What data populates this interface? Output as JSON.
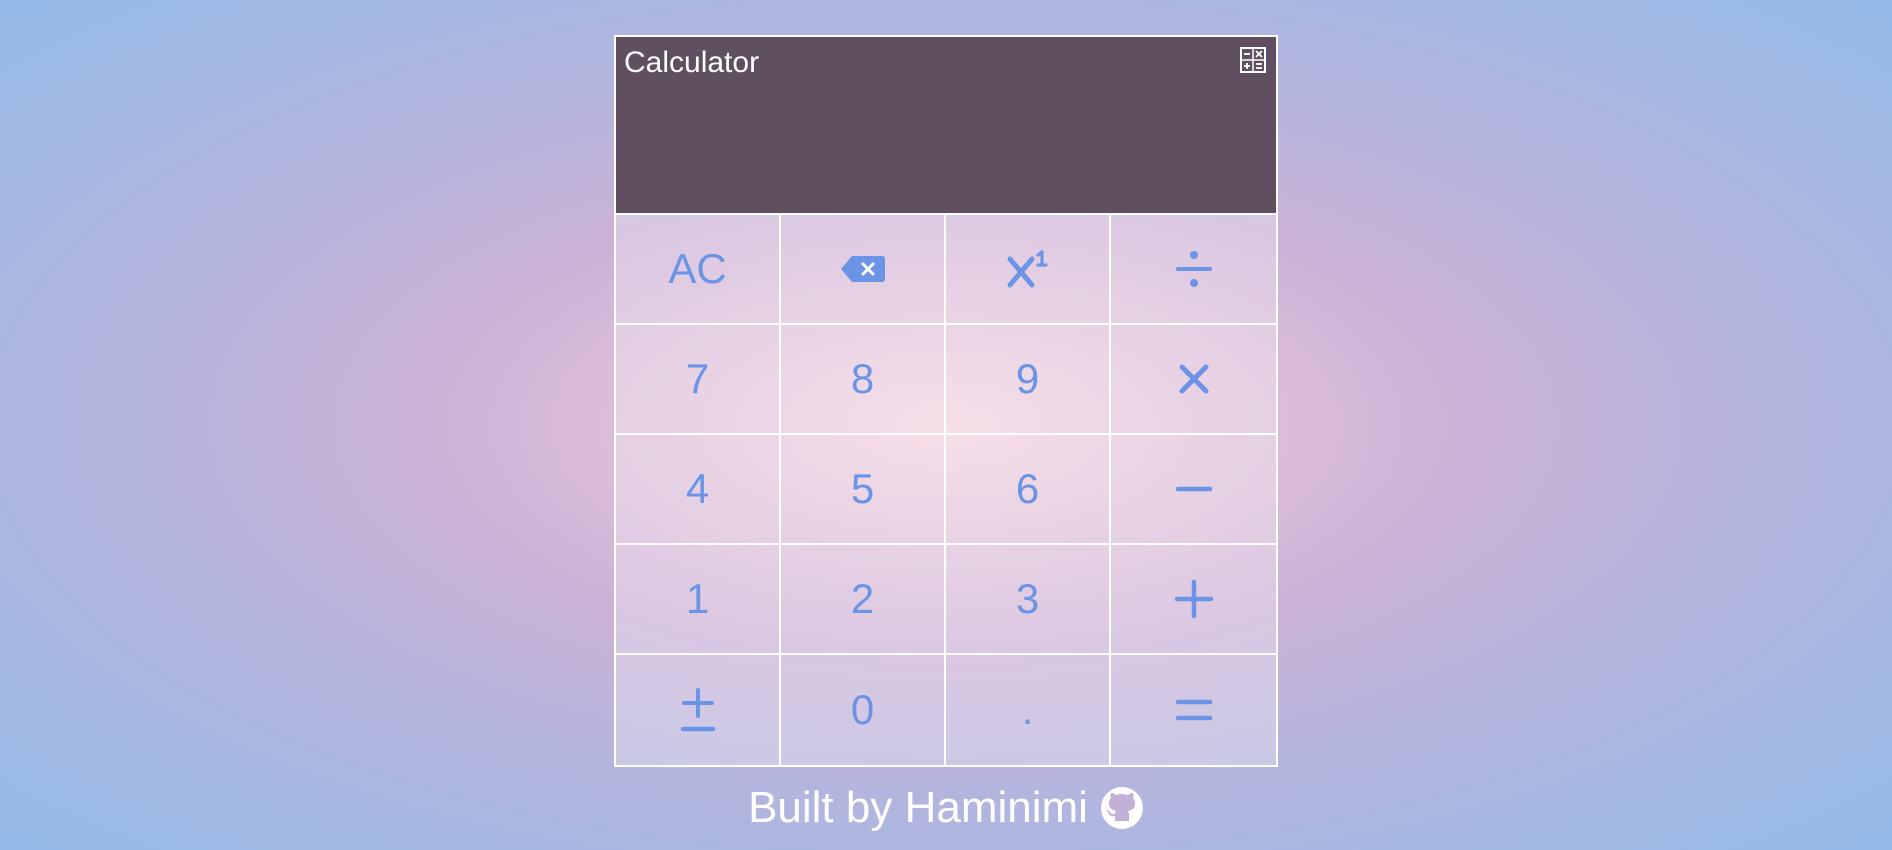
{
  "app": {
    "title": "Calculator",
    "display_value": ""
  },
  "icons": {
    "calculator": "calculator-icon",
    "backspace": "backspace-icon",
    "power": "power-icon",
    "divide": "divide-icon",
    "multiply": "multiply-icon",
    "minus": "minus-icon",
    "plus": "plus-icon",
    "plus_minus": "plus-minus-icon",
    "equals": "equals-icon",
    "github": "github-icon"
  },
  "keys": {
    "clear": "AC",
    "seven": "7",
    "eight": "8",
    "nine": "9",
    "four": "4",
    "five": "5",
    "six": "6",
    "one": "1",
    "two": "2",
    "three": "3",
    "zero": "0",
    "decimal": "."
  },
  "footer": {
    "text": "Built by Haminimi"
  },
  "colors": {
    "display_bg": "#5f4f60",
    "key_text": "#6b93e6",
    "border": "#ffffff"
  }
}
